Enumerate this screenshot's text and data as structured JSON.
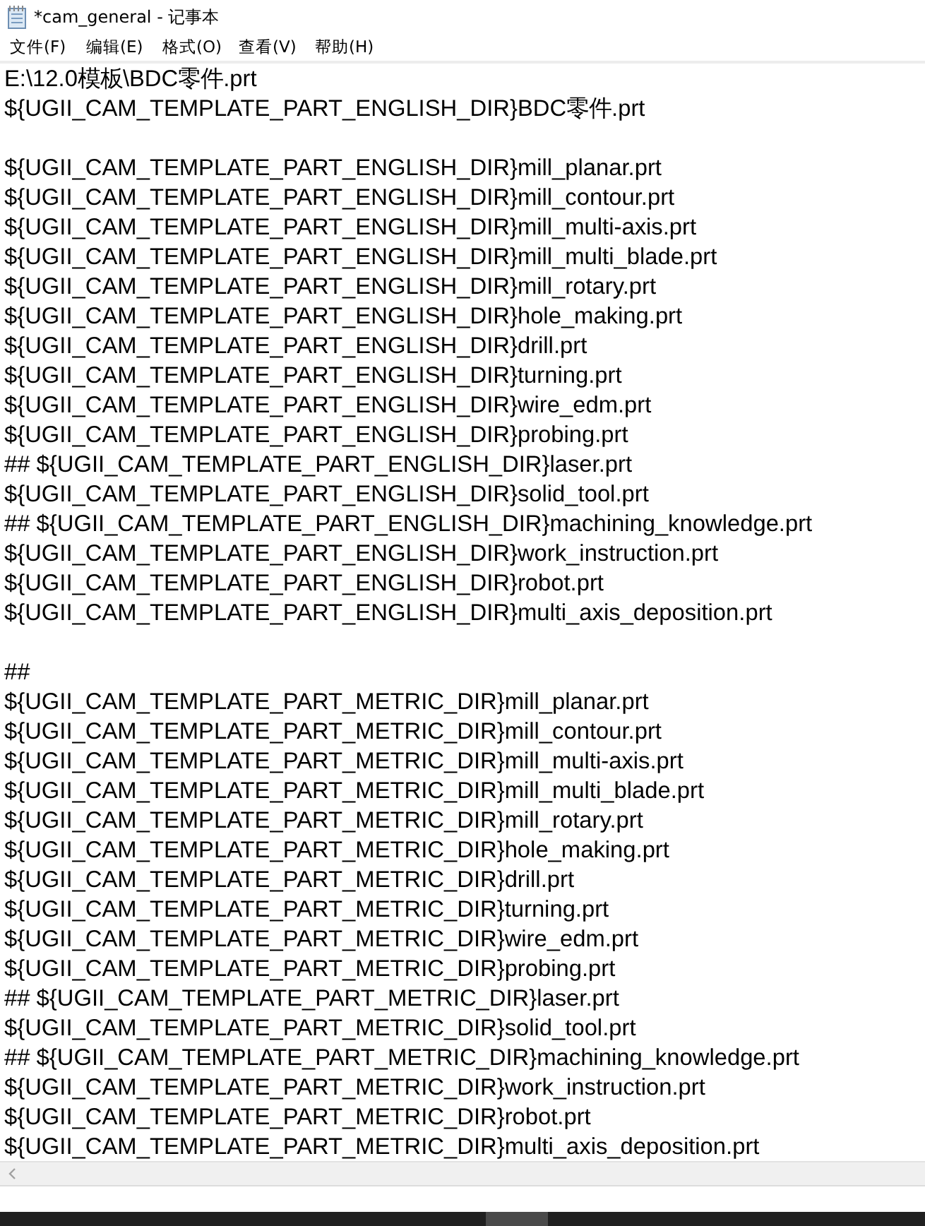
{
  "window": {
    "title": "*cam_general - 记事本"
  },
  "menu": [
    {
      "label": "文件(F)"
    },
    {
      "label": "编辑(E)"
    },
    {
      "label": "格式(O)"
    },
    {
      "label": "查看(V)"
    },
    {
      "label": "帮助(H)"
    }
  ],
  "lines": [
    {
      "kind": "text",
      "text": "E:\\12.0模板\\BDC零件.prt"
    },
    {
      "kind": "text",
      "text": "${UGII_CAM_TEMPLATE_PART_ENGLISH_DIR}BDC零件.prt"
    },
    {
      "kind": "blank"
    },
    {
      "kind": "text",
      "text": "${UGII_CAM_TEMPLATE_PART_ENGLISH_DIR}mill_planar.prt"
    },
    {
      "kind": "text",
      "text": "${UGII_CAM_TEMPLATE_PART_ENGLISH_DIR}mill_contour.prt"
    },
    {
      "kind": "text",
      "text": "${UGII_CAM_TEMPLATE_PART_ENGLISH_DIR}mill_multi-axis.prt"
    },
    {
      "kind": "text",
      "text": "${UGII_CAM_TEMPLATE_PART_ENGLISH_DIR}mill_multi_blade.prt"
    },
    {
      "kind": "text",
      "text": "${UGII_CAM_TEMPLATE_PART_ENGLISH_DIR}mill_rotary.prt"
    },
    {
      "kind": "text",
      "text": "${UGII_CAM_TEMPLATE_PART_ENGLISH_DIR}hole_making.prt"
    },
    {
      "kind": "text",
      "text": "${UGII_CAM_TEMPLATE_PART_ENGLISH_DIR}drill.prt"
    },
    {
      "kind": "text",
      "text": "${UGII_CAM_TEMPLATE_PART_ENGLISH_DIR}turning.prt"
    },
    {
      "kind": "text",
      "text": "${UGII_CAM_TEMPLATE_PART_ENGLISH_DIR}wire_edm.prt"
    },
    {
      "kind": "text",
      "text": "${UGII_CAM_TEMPLATE_PART_ENGLISH_DIR}probing.prt"
    },
    {
      "kind": "text",
      "text": "## ${UGII_CAM_TEMPLATE_PART_ENGLISH_DIR}laser.prt"
    },
    {
      "kind": "text",
      "text": "${UGII_CAM_TEMPLATE_PART_ENGLISH_DIR}solid_tool.prt"
    },
    {
      "kind": "text",
      "text": "## ${UGII_CAM_TEMPLATE_PART_ENGLISH_DIR}machining_knowledge.prt"
    },
    {
      "kind": "text",
      "text": "${UGII_CAM_TEMPLATE_PART_ENGLISH_DIR}work_instruction.prt"
    },
    {
      "kind": "text",
      "text": "${UGII_CAM_TEMPLATE_PART_ENGLISH_DIR}robot.prt"
    },
    {
      "kind": "text",
      "text": "${UGII_CAM_TEMPLATE_PART_ENGLISH_DIR}multi_axis_deposition.prt"
    },
    {
      "kind": "blank"
    },
    {
      "kind": "text",
      "text": "##"
    },
    {
      "kind": "text",
      "text": "${UGII_CAM_TEMPLATE_PART_METRIC_DIR}mill_planar.prt"
    },
    {
      "kind": "text",
      "text": "${UGII_CAM_TEMPLATE_PART_METRIC_DIR}mill_contour.prt"
    },
    {
      "kind": "text",
      "text": "${UGII_CAM_TEMPLATE_PART_METRIC_DIR}mill_multi-axis.prt"
    },
    {
      "kind": "text",
      "text": "${UGII_CAM_TEMPLATE_PART_METRIC_DIR}mill_multi_blade.prt"
    },
    {
      "kind": "text",
      "text": "${UGII_CAM_TEMPLATE_PART_METRIC_DIR}mill_rotary.prt"
    },
    {
      "kind": "text",
      "text": "${UGII_CAM_TEMPLATE_PART_METRIC_DIR}hole_making.prt"
    },
    {
      "kind": "text",
      "text": "${UGII_CAM_TEMPLATE_PART_METRIC_DIR}drill.prt"
    },
    {
      "kind": "text",
      "text": "${UGII_CAM_TEMPLATE_PART_METRIC_DIR}turning.prt"
    },
    {
      "kind": "text",
      "text": "${UGII_CAM_TEMPLATE_PART_METRIC_DIR}wire_edm.prt"
    },
    {
      "kind": "text",
      "text": "${UGII_CAM_TEMPLATE_PART_METRIC_DIR}probing.prt"
    },
    {
      "kind": "text",
      "text": "## ${UGII_CAM_TEMPLATE_PART_METRIC_DIR}laser.prt"
    },
    {
      "kind": "text",
      "text": "${UGII_CAM_TEMPLATE_PART_METRIC_DIR}solid_tool.prt"
    },
    {
      "kind": "text",
      "text": "## ${UGII_CAM_TEMPLATE_PART_METRIC_DIR}machining_knowledge.prt"
    },
    {
      "kind": "text",
      "text": "${UGII_CAM_TEMPLATE_PART_METRIC_DIR}work_instruction.prt"
    },
    {
      "kind": "text",
      "text": "${UGII_CAM_TEMPLATE_PART_METRIC_DIR}robot.prt"
    },
    {
      "kind": "text",
      "text": "${UGII_CAM_TEMPLATE_PART_METRIC_DIR}multi_axis_deposition.prt"
    }
  ]
}
